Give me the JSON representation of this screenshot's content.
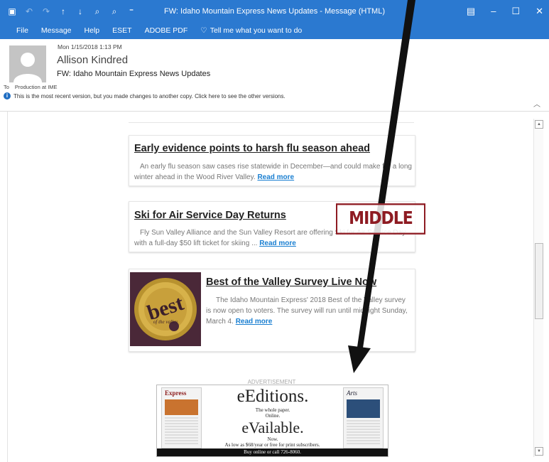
{
  "window": {
    "title": "FW: Idaho Mountain Express News Updates  -  Message (HTML)"
  },
  "menu": {
    "items": [
      "File",
      "Message",
      "Help",
      "ESET",
      "ADOBE PDF"
    ],
    "tell_me": "Tell me what you want to do"
  },
  "message": {
    "date": "Mon 1/15/2018 1:13 PM",
    "from": "Allison Kindred",
    "subject": "FW: Idaho Mountain Express News Updates",
    "to_label": "To",
    "to_value": "Production at IME",
    "info": "This is the most recent version, but you made changes to another copy. Click here to see the other versions."
  },
  "articles": [
    {
      "title": "Early evidence points to harsh flu season ahead",
      "body": "An early flu season saw cases rise statewide in December—and could make for a long winter ahead in the Wood River Valley.",
      "link": "Read more"
    },
    {
      "title": "Ski for Air Service Day Returns",
      "body": "Fly Sun Valley Alliance and the Sun Valley Resort are offering Ski for Air Service Day with a full-day $50 lift ticket for skiing ...",
      "link": "Read more"
    },
    {
      "title": "Best of the Valley Survey Live Now",
      "body": "The Idaho Mountain Express' 2018 Best of the Valley survey is now open to voters. The survey will run until midnight Sunday, March 4.",
      "link": "Read more",
      "badge_text": "best",
      "badge_sub": "of the valley"
    }
  ],
  "ad": {
    "label": "ADVERTISEMENT",
    "line1": "eEditions.",
    "line2": "The whole paper.",
    "line3": "Online.",
    "line4": "eVailable.",
    "line5": "Now.",
    "line6": "As low as $68/year or free for print subscribers.",
    "cta": "Buy online or call 726-8060.",
    "paper1_masthead": "Express",
    "paper2_masthead": "Arts"
  },
  "annotation": {
    "stamp": "MIDDLE"
  },
  "colors": {
    "accent": "#2b79d0",
    "link": "#1a7fd1",
    "stamp": "#8e1b22"
  }
}
